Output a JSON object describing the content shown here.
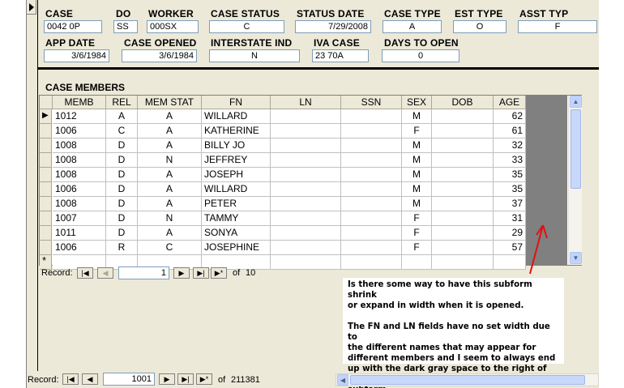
{
  "header_fields": {
    "case": {
      "label": "CASE",
      "value": "0042      0P"
    },
    "do": {
      "label": "DO",
      "value": "SS"
    },
    "worker": {
      "label": "WORKER",
      "value": "000SX"
    },
    "case_status": {
      "label": "CASE STATUS",
      "value": "C"
    },
    "status_date": {
      "label": "STATUS DATE",
      "value": "7/29/2008"
    },
    "case_type": {
      "label": "CASE TYPE",
      "value": "A"
    },
    "est_type": {
      "label": "EST TYPE",
      "value": "O"
    },
    "asst_typ": {
      "label": "ASST TYP",
      "value": "F"
    },
    "app_date": {
      "label": "APP DATE",
      "value": "3/6/1984"
    },
    "case_opened": {
      "label": "CASE OPENED",
      "value": "3/6/1984"
    },
    "interstate_ind": {
      "label": "INTERSTATE IND",
      "value": "N"
    },
    "iva_case": {
      "label": "IVA CASE",
      "value": "23      70A"
    },
    "days_to_open": {
      "label": "DAYS TO OPEN",
      "value": "0"
    }
  },
  "subform": {
    "title": "CASE MEMBERS",
    "columns": [
      "MEMB",
      "REL",
      "MEM STAT",
      "FN",
      "LN",
      "SSN",
      "SEX",
      "DOB",
      "AGE"
    ],
    "rows": [
      [
        "1012",
        "A",
        "A",
        "WILLARD",
        "",
        "",
        "M",
        "",
        "62"
      ],
      [
        "1006",
        "C",
        "A",
        "KATHERINE",
        "",
        "",
        "F",
        "",
        "61"
      ],
      [
        "1008",
        "D",
        "A",
        "BILLY JO",
        "",
        "",
        "M",
        "",
        "32"
      ],
      [
        "1008",
        "D",
        "N",
        "JEFFREY",
        "",
        "",
        "M",
        "",
        "33"
      ],
      [
        "1008",
        "D",
        "A",
        "JOSEPH",
        "",
        "",
        "M",
        "",
        "35"
      ],
      [
        "1006",
        "D",
        "A",
        "WILLARD",
        "",
        "",
        "M",
        "",
        "35"
      ],
      [
        "1008",
        "D",
        "A",
        "PETER",
        "",
        "",
        "M",
        "",
        "37"
      ],
      [
        "1007",
        "D",
        "N",
        "TAMMY",
        "",
        "",
        "F",
        "",
        "31"
      ],
      [
        "1011",
        "D",
        "A",
        "SONYA",
        "",
        "",
        "F",
        "",
        "29"
      ],
      [
        "1006",
        "R",
        "C",
        "JOSEPHINE",
        "",
        "",
        "F",
        "",
        "57"
      ]
    ],
    "new_row_marker": "*",
    "current_row_marker": "▶",
    "nav": {
      "label": "Record:",
      "current": "1",
      "of": "of",
      "total": "10"
    }
  },
  "main_nav": {
    "label": "Record:",
    "current": "1001",
    "of": "of",
    "total": "211381"
  },
  "note": {
    "p1": "Is there some way to have this subform shrink\nor expand in width when it is opened.",
    "p2": "The FN and LN fields have no set width due to\nthe different names that may appear for\ndifferent members and I seem to always end\nup with the dark gray space to the right of the\nsubform."
  },
  "colors": {
    "annotation_arrow": "#e01010",
    "empty_area": "#808080",
    "form_bg": "#ece9d8"
  },
  "icons": {
    "first": "first-record-icon",
    "prev": "previous-record-icon",
    "next": "next-record-icon",
    "last": "last-record-icon",
    "new": "new-record-icon"
  }
}
